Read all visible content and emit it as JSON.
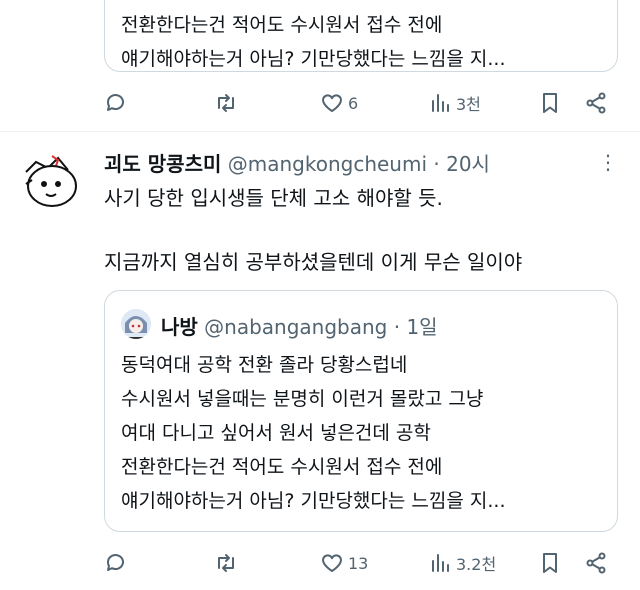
{
  "prev_tweet": {
    "quote_lines": [
      "전환한다는건 적어도 수시원서 접수 전에",
      "얘기해야하는거 아님? 기만당했다는 느낌을 지..."
    ],
    "actions": {
      "likes": "6",
      "views": "3천"
    }
  },
  "tweet": {
    "display_name": "괴도 망콩츠미",
    "handle": "@mangkongcheumi",
    "time": "· 20시",
    "more": "⋮",
    "text_lines": [
      "사기 당한 입시생들 단체 고소 해야할 듯.",
      "지금까지 열심히 공부하셨을텐데 이게 무슨 일이야"
    ],
    "quote": {
      "display_name": "나방",
      "handle": "@nabangangbang",
      "time": "· 1일",
      "lines": [
        "동덕여대 공학 전환 졸라 당황스럽네",
        "수시원서 넣을때는 분명히 이런거 몰랐고 그냥",
        "여대 다니고 싶어서 원서 넣은건데 공학",
        "전환한다는건 적어도 수시원서 접수 전에",
        "얘기해야하는거 아님? 기만당했다는 느낌을 지..."
      ]
    },
    "actions": {
      "likes": "13",
      "views": "3.2천"
    }
  },
  "icons": [
    "reply-icon",
    "retweet-icon",
    "like-icon",
    "views-icon",
    "bookmark-icon",
    "share-icon"
  ],
  "colors": {
    "muted": "#536471",
    "border": "#cfd9de",
    "text": "#0f1419"
  }
}
